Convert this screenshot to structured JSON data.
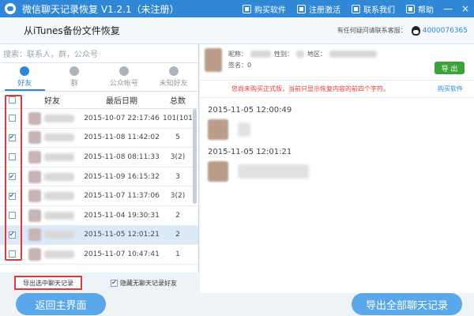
{
  "window": {
    "title": "微信聊天记录恢复 V1.2.1（未注册）",
    "menu": [
      "购买软件",
      "注册激活",
      "联系我们",
      "帮助"
    ],
    "controls": [
      "—",
      "×"
    ]
  },
  "header": {
    "title": "从iTunes备份文件恢复",
    "support_label": "有任何疑问请联系客服：",
    "support_number": "4000076365"
  },
  "left": {
    "search_placeholder": "搜索：联系人，群，公众号",
    "tabs": [
      {
        "label": "好友",
        "icon": "user-icon",
        "active": true
      },
      {
        "label": "群",
        "icon": "group-icon",
        "active": false
      },
      {
        "label": "公众帐号",
        "icon": "official-account-icon",
        "active": false
      },
      {
        "label": "未知好友",
        "icon": "unknown-friend-icon",
        "active": false
      }
    ],
    "columns": {
      "name": "好友",
      "date": "最后日期",
      "total": "总数"
    },
    "rows": [
      {
        "checked": false,
        "date": "2015-10-07 22:17:46",
        "total": "101(101)"
      },
      {
        "checked": true,
        "date": "2015-11-08 11:42:02",
        "total": "5"
      },
      {
        "checked": false,
        "date": "2015-11-08 08:11:33",
        "total": "3(2)"
      },
      {
        "checked": true,
        "date": "2015-11-09 16:15:32",
        "total": "3"
      },
      {
        "checked": true,
        "date": "2015-11-07 11:37:06",
        "total": "3(2)"
      },
      {
        "checked": false,
        "date": "2015-11-04 19:30:31",
        "total": "2"
      },
      {
        "checked": true,
        "date": "2015-11-05 12:01:21",
        "total": "2",
        "selected": true
      },
      {
        "checked": false,
        "date": "2015-11-07 10:47:41",
        "total": "1"
      }
    ],
    "export_selected": "导出选中聊天记录",
    "hide_empty": "隐藏无聊天记录好友",
    "hide_empty_checked": true
  },
  "right": {
    "nickname_label": "昵称：",
    "gender_label": "性别：",
    "region_label": "地区：",
    "signature_label": "签名：0",
    "sms_button": "导 出",
    "notice": "您尚未购买正式版，当前只显示恢复内容的前四个字符。",
    "buy_link": "购买软件",
    "messages": [
      {
        "time": "2015-11-05 12:00:49"
      },
      {
        "time": "2015-11-05 12:01:21"
      }
    ]
  },
  "footer": {
    "back_button": "返回主界面",
    "export_all_button": "导出全部聊天记录"
  },
  "colors": {
    "primary": "#2f87d6",
    "highlight": "#e23a3a",
    "button": "#5aa7ea"
  }
}
